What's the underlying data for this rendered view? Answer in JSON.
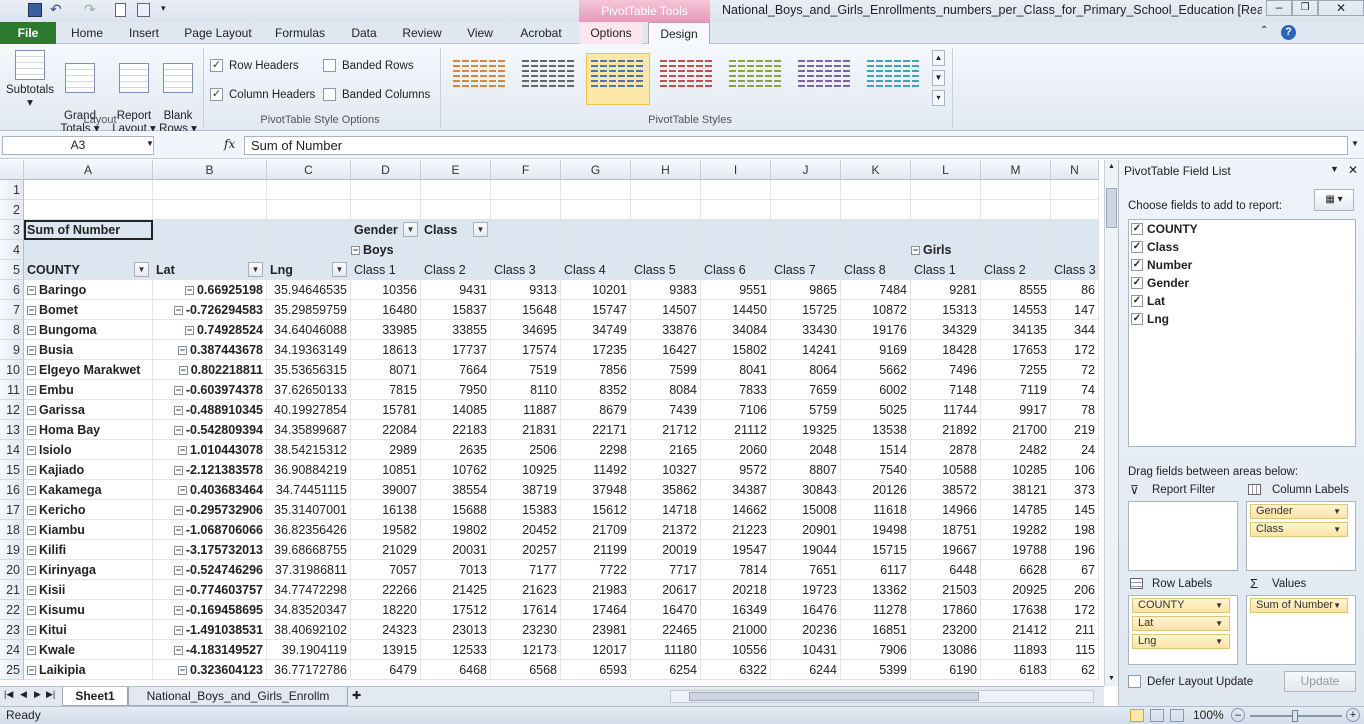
{
  "window": {
    "title": "National_Boys_and_Girls_Enrollments_numbers_per_Class_for_Primary_School_Education  [Read-...",
    "contextual_tab_group": "PivotTable Tools"
  },
  "ribbon_tabs": [
    {
      "label": "File"
    },
    {
      "label": "Home"
    },
    {
      "label": "Insert"
    },
    {
      "label": "Page Layout"
    },
    {
      "label": "Formulas"
    },
    {
      "label": "Data"
    },
    {
      "label": "Review"
    },
    {
      "label": "View"
    },
    {
      "label": "Acrobat"
    },
    {
      "label": "Options"
    },
    {
      "label": "Design"
    }
  ],
  "layout_group": {
    "label": "Layout",
    "buttons": [
      {
        "label": "Subtotals"
      },
      {
        "label": "Grand\nTotals ▾"
      },
      {
        "label": "Report\nLayout ▾"
      },
      {
        "label": "Blank\nRows ▾"
      }
    ]
  },
  "style_options": {
    "label": "PivotTable Style Options",
    "row_headers": "Row Headers",
    "column_headers": "Column Headers",
    "banded_rows": "Banded Rows",
    "banded_columns": "Banded Columns"
  },
  "styles_group": {
    "label": "PivotTable Styles"
  },
  "formula_bar": {
    "name_box": "A3",
    "fx": "fx",
    "formula": "Sum of Number"
  },
  "columns": [
    "A",
    "B",
    "C",
    "D",
    "E",
    "F",
    "G",
    "H",
    "I",
    "J",
    "K",
    "L",
    "M",
    "N"
  ],
  "pivot": {
    "title": "Sum of Number",
    "gender_label": "Gender",
    "class_label": "Class",
    "boys": "Boys",
    "girls": "Girls",
    "county_header": "COUNTY",
    "lat_header": "Lat",
    "lng_header": "Lng",
    "class_headers": [
      "Class 1",
      "Class 2",
      "Class 3",
      "Class 4",
      "Class 5",
      "Class 6",
      "Class 7",
      "Class 8",
      "Class 1",
      "Class 2",
      "Class 3"
    ],
    "rows": [
      {
        "county": "Baringo",
        "lat": "0.66925198",
        "lng": "35.94646535",
        "v": [
          "10356",
          "9431",
          "9313",
          "10201",
          "9383",
          "9551",
          "9865",
          "7484",
          "9281",
          "8555",
          "86"
        ]
      },
      {
        "county": "Bomet",
        "lat": "-0.726294583",
        "lng": "35.29859759",
        "v": [
          "16480",
          "15837",
          "15648",
          "15747",
          "14507",
          "14450",
          "15725",
          "10872",
          "15313",
          "14553",
          "147"
        ]
      },
      {
        "county": "Bungoma",
        "lat": "0.74928524",
        "lng": "34.64046088",
        "v": [
          "33985",
          "33855",
          "34695",
          "34749",
          "33876",
          "34084",
          "33430",
          "19176",
          "34329",
          "34135",
          "344"
        ]
      },
      {
        "county": "Busia",
        "lat": "0.387443678",
        "lng": "34.19363149",
        "v": [
          "18613",
          "17737",
          "17574",
          "17235",
          "16427",
          "15802",
          "14241",
          "9169",
          "18428",
          "17653",
          "172"
        ]
      },
      {
        "county": "Elgeyo Marakwet",
        "lat": "0.802218811",
        "lng": "35.53656315",
        "v": [
          "8071",
          "7664",
          "7519",
          "7856",
          "7599",
          "8041",
          "8064",
          "5662",
          "7496",
          "7255",
          "72"
        ]
      },
      {
        "county": "Embu",
        "lat": "-0.603974378",
        "lng": "37.62650133",
        "v": [
          "7815",
          "7950",
          "8110",
          "8352",
          "8084",
          "7833",
          "7659",
          "6002",
          "7148",
          "7119",
          "74"
        ]
      },
      {
        "county": "Garissa",
        "lat": "-0.488910345",
        "lng": "40.19927854",
        "v": [
          "15781",
          "14085",
          "11887",
          "8679",
          "7439",
          "7106",
          "5759",
          "5025",
          "11744",
          "9917",
          "78"
        ]
      },
      {
        "county": "Homa Bay",
        "lat": "-0.542809394",
        "lng": "34.35899687",
        "v": [
          "22084",
          "22183",
          "21831",
          "22171",
          "21712",
          "21112",
          "19325",
          "13538",
          "21892",
          "21700",
          "219"
        ]
      },
      {
        "county": "Isiolo",
        "lat": "1.010443078",
        "lng": "38.54215312",
        "v": [
          "2989",
          "2635",
          "2506",
          "2298",
          "2165",
          "2060",
          "2048",
          "1514",
          "2878",
          "2482",
          "24"
        ]
      },
      {
        "county": "Kajiado",
        "lat": "-2.121383578",
        "lng": "36.90884219",
        "v": [
          "10851",
          "10762",
          "10925",
          "11492",
          "10327",
          "9572",
          "8807",
          "7540",
          "10588",
          "10285",
          "106"
        ]
      },
      {
        "county": "Kakamega",
        "lat": "0.403683464",
        "lng": "34.74451115",
        "v": [
          "39007",
          "38554",
          "38719",
          "37948",
          "35862",
          "34387",
          "30843",
          "20126",
          "38572",
          "38121",
          "373"
        ]
      },
      {
        "county": "Kericho",
        "lat": "-0.295732906",
        "lng": "35.31407001",
        "v": [
          "16138",
          "15688",
          "15383",
          "15612",
          "14718",
          "14662",
          "15008",
          "11618",
          "14966",
          "14785",
          "145"
        ]
      },
      {
        "county": "Kiambu",
        "lat": "-1.068706066",
        "lng": "36.82356426",
        "v": [
          "19582",
          "19802",
          "20452",
          "21709",
          "21372",
          "21223",
          "20901",
          "19498",
          "18751",
          "19282",
          "198"
        ]
      },
      {
        "county": "Kilifi",
        "lat": "-3.175732013",
        "lng": "39.68668755",
        "v": [
          "21029",
          "20031",
          "20257",
          "21199",
          "20019",
          "19547",
          "19044",
          "15715",
          "19667",
          "19788",
          "196"
        ]
      },
      {
        "county": "Kirinyaga",
        "lat": "-0.524746296",
        "lng": "37.31986811",
        "v": [
          "7057",
          "7013",
          "7177",
          "7722",
          "7717",
          "7814",
          "7651",
          "6117",
          "6448",
          "6628",
          "67"
        ]
      },
      {
        "county": "Kisii",
        "lat": "-0.774603757",
        "lng": "34.77472298",
        "v": [
          "22266",
          "21425",
          "21623",
          "21983",
          "20617",
          "20218",
          "19723",
          "13362",
          "21503",
          "20925",
          "206"
        ]
      },
      {
        "county": "Kisumu",
        "lat": "-0.169458695",
        "lng": "34.83520347",
        "v": [
          "18220",
          "17512",
          "17614",
          "17464",
          "16470",
          "16349",
          "16476",
          "11278",
          "17860",
          "17638",
          "172"
        ]
      },
      {
        "county": "Kitui",
        "lat": "-1.491038531",
        "lng": "38.40692102",
        "v": [
          "24323",
          "23013",
          "23230",
          "23981",
          "22465",
          "21000",
          "20236",
          "16851",
          "23200",
          "21412",
          "211"
        ]
      },
      {
        "county": "Kwale",
        "lat": "-4.183149527",
        "lng": "39.1904119",
        "v": [
          "13915",
          "12533",
          "12173",
          "12017",
          "11180",
          "10556",
          "10431",
          "7906",
          "13086",
          "11893",
          "115"
        ]
      },
      {
        "county": "Laikipia",
        "lat": "0.323604123",
        "lng": "36.77172786",
        "v": [
          "6479",
          "6468",
          "6568",
          "6593",
          "6254",
          "6322",
          "6244",
          "5399",
          "6190",
          "6183",
          "62"
        ]
      }
    ]
  },
  "field_list": {
    "title": "PivotTable Field List",
    "choose_label": "Choose fields to add to report:",
    "fields": [
      "COUNTY",
      "Class",
      "Number",
      "Gender",
      "Lat",
      "Lng"
    ],
    "drag_label": "Drag fields between areas below:",
    "report_filter": "Report Filter",
    "column_labels": "Column Labels",
    "row_labels": "Row Labels",
    "values": "Values",
    "column_items": [
      "Gender",
      "Class"
    ],
    "row_items": [
      "COUNTY",
      "Lat",
      "Lng"
    ],
    "value_items": [
      "Sum of Number"
    ],
    "defer_label": "Defer Layout Update",
    "update_button": "Update"
  },
  "sheet_tabs": [
    {
      "label": "Sheet1"
    },
    {
      "label": "National_Boys_and_Girls_Enrollm"
    }
  ],
  "status": {
    "ready": "Ready",
    "zoom": "100%"
  }
}
